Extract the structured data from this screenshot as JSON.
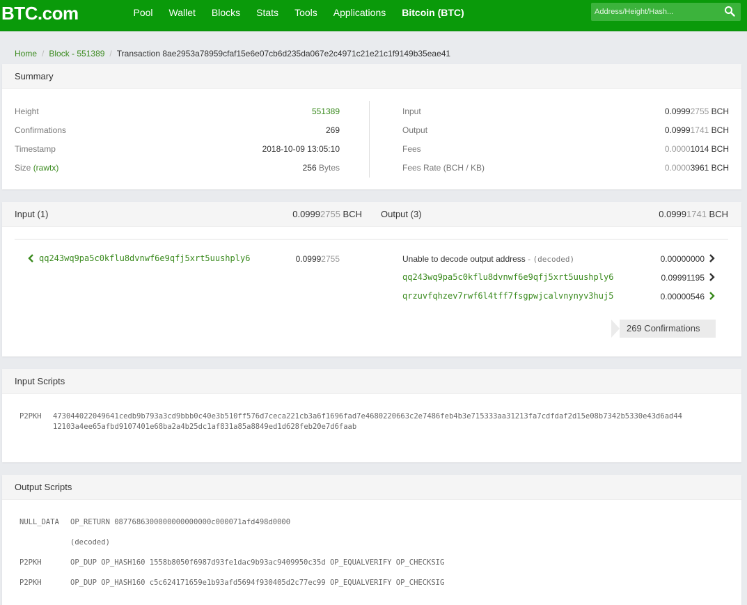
{
  "header": {
    "logo": "BTC.com",
    "nav": [
      "Pool",
      "Wallet",
      "Blocks",
      "Stats",
      "Tools",
      "Applications",
      "Bitcoin (BTC)"
    ],
    "search_placeholder": "Address/Height/Hash..."
  },
  "breadcrumb": {
    "home": "Home",
    "block": "Block - 551389",
    "current": "Transaction 8ae2953a78959cfaf15e6e07cb6d235da067e2c4971c21e21c1f9149b35eae41"
  },
  "summary": {
    "title": "Summary",
    "height_label": "Height",
    "height_value": "551389",
    "confirmations_label": "Confirmations",
    "confirmations_value": "269",
    "timestamp_label": "Timestamp",
    "timestamp_value": "2018-10-09 13:05:10",
    "size_label": "Size",
    "size_link": "(rawtx)",
    "size_value": "256",
    "size_unit": "Bytes",
    "input_label": "Input",
    "input_value_main": "0.0999",
    "input_value_dim": "2755",
    "output_label": "Output",
    "output_value_main": "0.0999",
    "output_value_dim": "1741",
    "fees_label": "Fees",
    "fees_value_dim": "0.0000",
    "fees_value_main": "1014",
    "feerate_label": "Fees Rate (BCH / KB)",
    "feerate_value_dim": "0.0000",
    "feerate_value_main": "3961",
    "unit": "BCH"
  },
  "io": {
    "input_title": "Input (1)",
    "input_total_main": "0.0999",
    "input_total_dim": "2755",
    "output_title": "Output (3)",
    "output_total_main": "0.0999",
    "output_total_dim": "1741",
    "unit": "BCH",
    "inputs": [
      {
        "address": "qq243wq9pa5c0kflu8dvnwf6e9qfj5xrt5uushply6",
        "amount_main": "0.0999",
        "amount_dim": "2755"
      }
    ],
    "outputs": [
      {
        "label": "Unable to decode output address",
        "sep": "-",
        "decoded": "(decoded)",
        "amount": "0.00000000"
      },
      {
        "address": "qq243wq9pa5c0kflu8dvnwf6e9qfj5xrt5uushply6",
        "amount": "0.09991195"
      },
      {
        "address": "qrzuvfqhzev7rwf6l4tff7fsgpwjcalvnynyv3huj5",
        "amount": "0.00000546"
      }
    ],
    "confirmations_badge": "269 Confirmations"
  },
  "input_scripts": {
    "title": "Input Scripts",
    "type": "P2PKH",
    "line1": "473044022049641cedb9b793a3cd9bbb0c40e3b510ff576d7ceca221cb3a6f1696fad7e4680220663c2e7486feb4b3e715333aa31213fa7cdfdaf2d15e08b7342b5330e43d6ad44",
    "line2": "12103a4ee65afbd9107401e68ba2a4b25dc1af831a85a8849ed1d628feb20e7d6faab"
  },
  "output_scripts": {
    "title": "Output Scripts",
    "rows": [
      {
        "type": "NULL_DATA",
        "script": "OP_RETURN 0877686300000000000000c000071afd498d0000"
      },
      {
        "type": "",
        "script": "(decoded)"
      },
      {
        "type": "P2PKH",
        "script": "OP_DUP OP_HASH160 1558b8050f6987d93fe1dac9b93ac9409950c35d OP_EQUALVERIFY OP_CHECKSIG"
      },
      {
        "type": "P2PKH",
        "script": "OP_DUP OP_HASH160 c5c624171659e1b93afd5694f930405d2c77ec99 OP_EQUALVERIFY OP_CHECKSIG"
      }
    ]
  }
}
